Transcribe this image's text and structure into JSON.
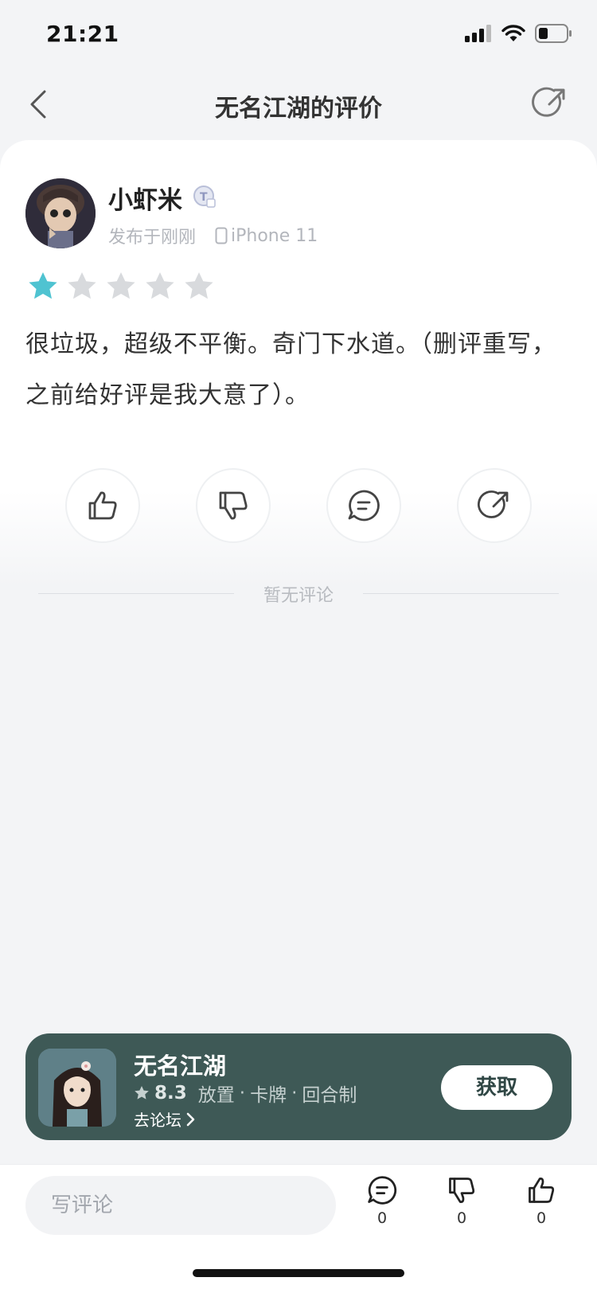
{
  "status_bar": {
    "time": "21:21"
  },
  "nav": {
    "title": "无名江湖的评价",
    "back_icon": "chevron-left-icon",
    "share_icon": "share-icon"
  },
  "review": {
    "user_name": "小虾米",
    "badge_icon": "user-level-badge-icon",
    "posted_time": "发布于刚刚",
    "device": "iPhone 11",
    "rating": 1,
    "rating_max": 5,
    "star_active_color": "#4fc3d1",
    "star_inactive_color": "#d8dadd",
    "text": "很垃圾，超级不平衡。奇门下水道。（删评重写，之前给好评是我大意了）。"
  },
  "actions": [
    {
      "name": "like",
      "icon": "thumbs-up-icon"
    },
    {
      "name": "dislike",
      "icon": "thumbs-down-icon"
    },
    {
      "name": "comment",
      "icon": "comment-icon"
    },
    {
      "name": "share",
      "icon": "share-icon"
    }
  ],
  "comments_empty_text": "暂无评论",
  "promo": {
    "game_name": "无名江湖",
    "score": "8.3",
    "tags": [
      "放置",
      "卡牌",
      "回合制"
    ],
    "separator": "·",
    "forum_link": "去论坛",
    "get_button": "获取",
    "bg_color": "#3e5956"
  },
  "bottom_bar": {
    "input_placeholder": "写评论",
    "comment_count": "0",
    "dislike_count": "0",
    "like_count": "0"
  }
}
